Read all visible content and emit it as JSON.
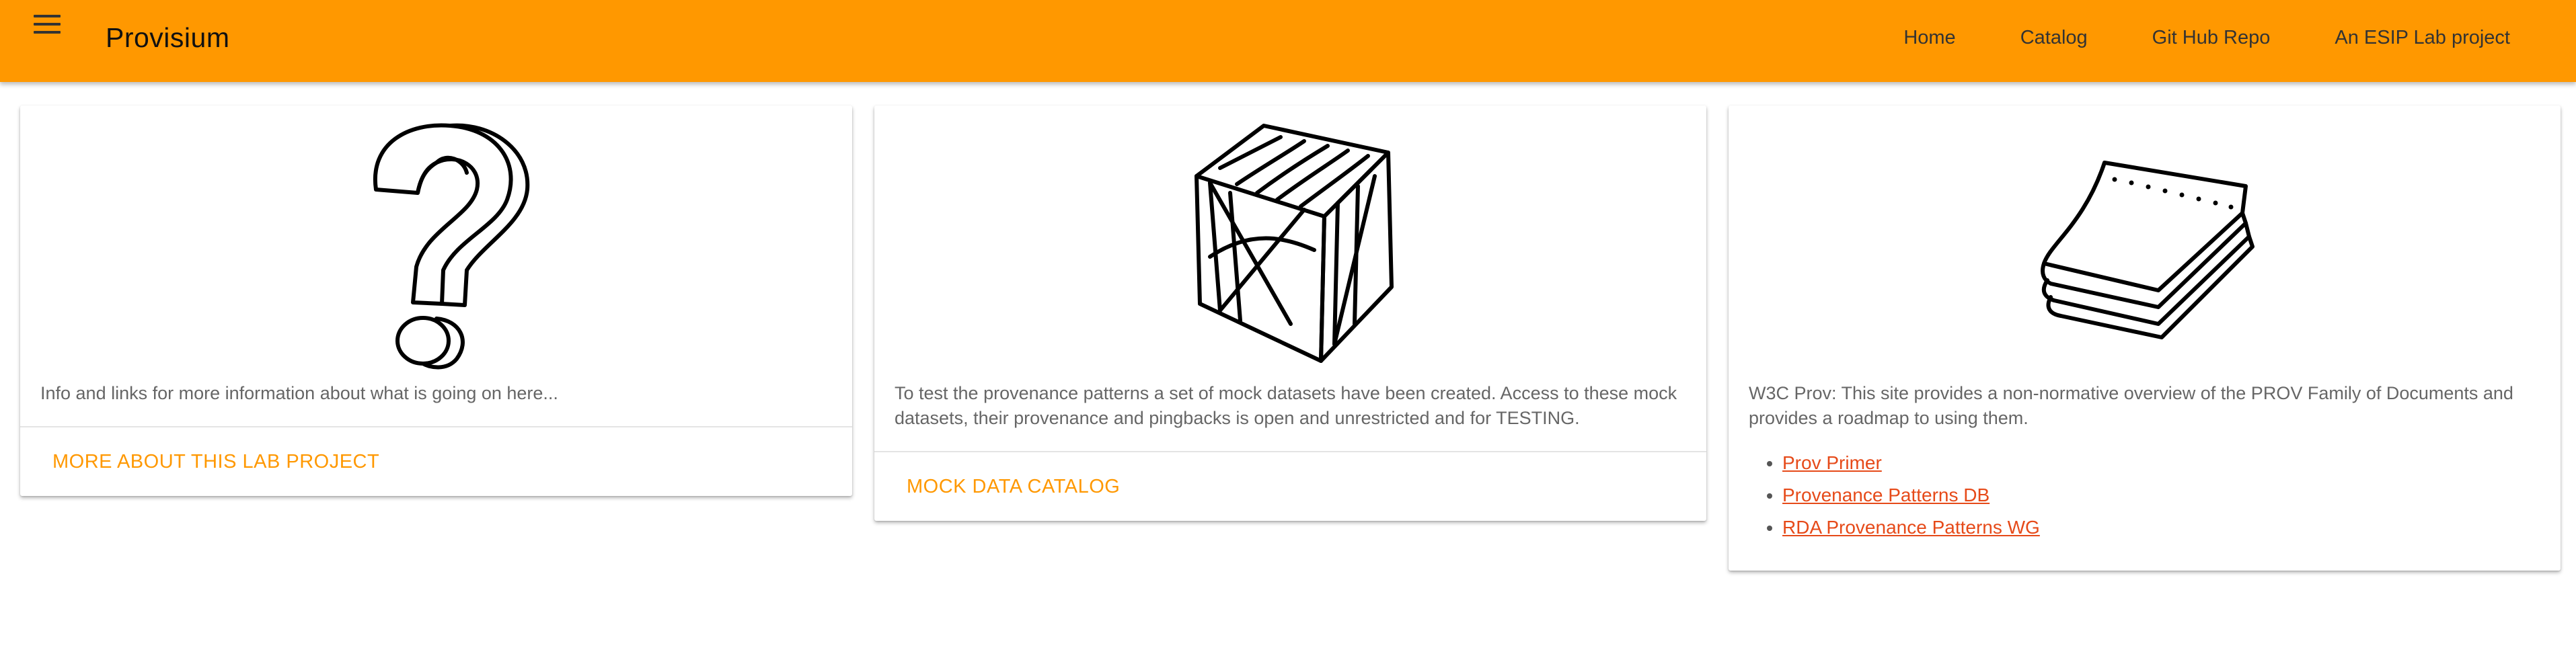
{
  "header": {
    "title": "Provisium",
    "nav": [
      "Home",
      "Catalog",
      "Git Hub Repo",
      "An ESIP Lab project"
    ]
  },
  "cards": [
    {
      "image": "question-mark-illustration",
      "text": "Info and links for more information about what is going on here...",
      "action": "MORE ABOUT THIS LAB PROJECT"
    },
    {
      "image": "wooden-crate-illustration",
      "text": "To test the provenance patterns a set of mock datasets have been created. Access to these mock datasets, their provenance and pingbacks is open and unrestricted and for TESTING.",
      "action": "MOCK DATA CATALOG"
    },
    {
      "image": "paper-stack-illustration",
      "text": "W3C Prov: This site provides a non-normative overview of the PROV Family of Documents and provides a roadmap to using them.",
      "links": [
        "Prov Primer",
        "Provenance Patterns DB",
        "RDA Provenance Patterns WG"
      ]
    }
  ],
  "colors": {
    "accent": "#ff9800",
    "link": "#e64a19"
  }
}
